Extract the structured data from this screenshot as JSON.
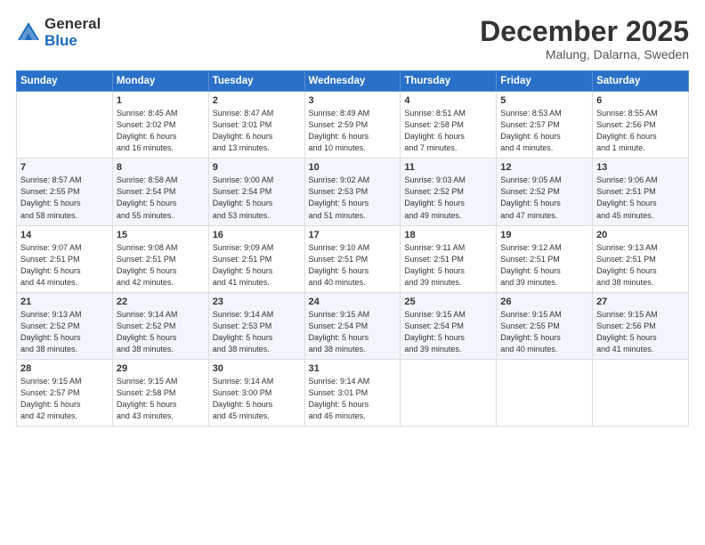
{
  "logo": {
    "general": "General",
    "blue": "Blue"
  },
  "title": "December 2025",
  "location": "Malung, Dalarna, Sweden",
  "weekdays": [
    "Sunday",
    "Monday",
    "Tuesday",
    "Wednesday",
    "Thursday",
    "Friday",
    "Saturday"
  ],
  "weeks": [
    [
      {
        "day": "",
        "info": ""
      },
      {
        "day": "1",
        "info": "Sunrise: 8:45 AM\nSunset: 3:02 PM\nDaylight: 6 hours\nand 16 minutes."
      },
      {
        "day": "2",
        "info": "Sunrise: 8:47 AM\nSunset: 3:01 PM\nDaylight: 6 hours\nand 13 minutes."
      },
      {
        "day": "3",
        "info": "Sunrise: 8:49 AM\nSunset: 2:59 PM\nDaylight: 6 hours\nand 10 minutes."
      },
      {
        "day": "4",
        "info": "Sunrise: 8:51 AM\nSunset: 2:58 PM\nDaylight: 6 hours\nand 7 minutes."
      },
      {
        "day": "5",
        "info": "Sunrise: 8:53 AM\nSunset: 2:57 PM\nDaylight: 6 hours\nand 4 minutes."
      },
      {
        "day": "6",
        "info": "Sunrise: 8:55 AM\nSunset: 2:56 PM\nDaylight: 6 hours\nand 1 minute."
      }
    ],
    [
      {
        "day": "7",
        "info": "Sunrise: 8:57 AM\nSunset: 2:55 PM\nDaylight: 5 hours\nand 58 minutes."
      },
      {
        "day": "8",
        "info": "Sunrise: 8:58 AM\nSunset: 2:54 PM\nDaylight: 5 hours\nand 55 minutes."
      },
      {
        "day": "9",
        "info": "Sunrise: 9:00 AM\nSunset: 2:54 PM\nDaylight: 5 hours\nand 53 minutes."
      },
      {
        "day": "10",
        "info": "Sunrise: 9:02 AM\nSunset: 2:53 PM\nDaylight: 5 hours\nand 51 minutes."
      },
      {
        "day": "11",
        "info": "Sunrise: 9:03 AM\nSunset: 2:52 PM\nDaylight: 5 hours\nand 49 minutes."
      },
      {
        "day": "12",
        "info": "Sunrise: 9:05 AM\nSunset: 2:52 PM\nDaylight: 5 hours\nand 47 minutes."
      },
      {
        "day": "13",
        "info": "Sunrise: 9:06 AM\nSunset: 2:51 PM\nDaylight: 5 hours\nand 45 minutes."
      }
    ],
    [
      {
        "day": "14",
        "info": "Sunrise: 9:07 AM\nSunset: 2:51 PM\nDaylight: 5 hours\nand 44 minutes."
      },
      {
        "day": "15",
        "info": "Sunrise: 9:08 AM\nSunset: 2:51 PM\nDaylight: 5 hours\nand 42 minutes."
      },
      {
        "day": "16",
        "info": "Sunrise: 9:09 AM\nSunset: 2:51 PM\nDaylight: 5 hours\nand 41 minutes."
      },
      {
        "day": "17",
        "info": "Sunrise: 9:10 AM\nSunset: 2:51 PM\nDaylight: 5 hours\nand 40 minutes."
      },
      {
        "day": "18",
        "info": "Sunrise: 9:11 AM\nSunset: 2:51 PM\nDaylight: 5 hours\nand 39 minutes."
      },
      {
        "day": "19",
        "info": "Sunrise: 9:12 AM\nSunset: 2:51 PM\nDaylight: 5 hours\nand 39 minutes."
      },
      {
        "day": "20",
        "info": "Sunrise: 9:13 AM\nSunset: 2:51 PM\nDaylight: 5 hours\nand 38 minutes."
      }
    ],
    [
      {
        "day": "21",
        "info": "Sunrise: 9:13 AM\nSunset: 2:52 PM\nDaylight: 5 hours\nand 38 minutes."
      },
      {
        "day": "22",
        "info": "Sunrise: 9:14 AM\nSunset: 2:52 PM\nDaylight: 5 hours\nand 38 minutes."
      },
      {
        "day": "23",
        "info": "Sunrise: 9:14 AM\nSunset: 2:53 PM\nDaylight: 5 hours\nand 38 minutes."
      },
      {
        "day": "24",
        "info": "Sunrise: 9:15 AM\nSunset: 2:54 PM\nDaylight: 5 hours\nand 38 minutes."
      },
      {
        "day": "25",
        "info": "Sunrise: 9:15 AM\nSunset: 2:54 PM\nDaylight: 5 hours\nand 39 minutes."
      },
      {
        "day": "26",
        "info": "Sunrise: 9:15 AM\nSunset: 2:55 PM\nDaylight: 5 hours\nand 40 minutes."
      },
      {
        "day": "27",
        "info": "Sunrise: 9:15 AM\nSunset: 2:56 PM\nDaylight: 5 hours\nand 41 minutes."
      }
    ],
    [
      {
        "day": "28",
        "info": "Sunrise: 9:15 AM\nSunset: 2:57 PM\nDaylight: 5 hours\nand 42 minutes."
      },
      {
        "day": "29",
        "info": "Sunrise: 9:15 AM\nSunset: 2:58 PM\nDaylight: 5 hours\nand 43 minutes."
      },
      {
        "day": "30",
        "info": "Sunrise: 9:14 AM\nSunset: 3:00 PM\nDaylight: 5 hours\nand 45 minutes."
      },
      {
        "day": "31",
        "info": "Sunrise: 9:14 AM\nSunset: 3:01 PM\nDaylight: 5 hours\nand 46 minutes."
      },
      {
        "day": "",
        "info": ""
      },
      {
        "day": "",
        "info": ""
      },
      {
        "day": "",
        "info": ""
      }
    ]
  ]
}
